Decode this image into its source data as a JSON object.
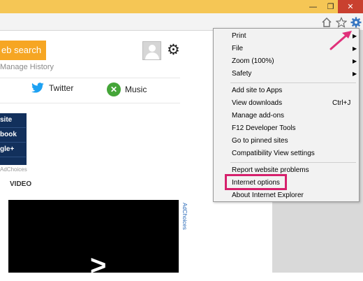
{
  "window": {
    "minimize_glyph": "—",
    "maximize_glyph": "❐",
    "close_glyph": "✕"
  },
  "toolbar": {
    "home_icon": "home-icon",
    "favorites_icon": "star-icon",
    "tools_icon": "gear-icon"
  },
  "page": {
    "search_button": "eb search",
    "manage_history": "Manage History",
    "social": [
      {
        "label": "Twitter"
      },
      {
        "label": "Music"
      }
    ],
    "ad_items": [
      "site",
      "book",
      "gle+"
    ],
    "adchoices_small": "AdChoices",
    "video_label": "VIDEO",
    "video_glyph": ">",
    "adchoices_vertical": "AdChoices"
  },
  "menu": {
    "items": [
      {
        "label": "Print",
        "submenu": true
      },
      {
        "label": "File",
        "submenu": true
      },
      {
        "label": "Zoom (100%)",
        "submenu": true
      },
      {
        "label": "Safety",
        "submenu": true
      },
      {
        "label": "Add site to Apps"
      },
      {
        "label": "View downloads",
        "shortcut": "Ctrl+J"
      },
      {
        "label": "Manage add-ons"
      },
      {
        "label": "F12 Developer Tools"
      },
      {
        "label": "Go to pinned sites"
      },
      {
        "label": "Compatibility View settings"
      },
      {
        "label": "Report website problems"
      },
      {
        "label": "Internet options"
      },
      {
        "label": "About Internet Explorer"
      }
    ],
    "submenu_arrow": "▶"
  },
  "colors": {
    "title_bar": "#f5c655",
    "close": "#c9402f",
    "search_button": "#f6a623",
    "highlight": "#d6206c"
  }
}
